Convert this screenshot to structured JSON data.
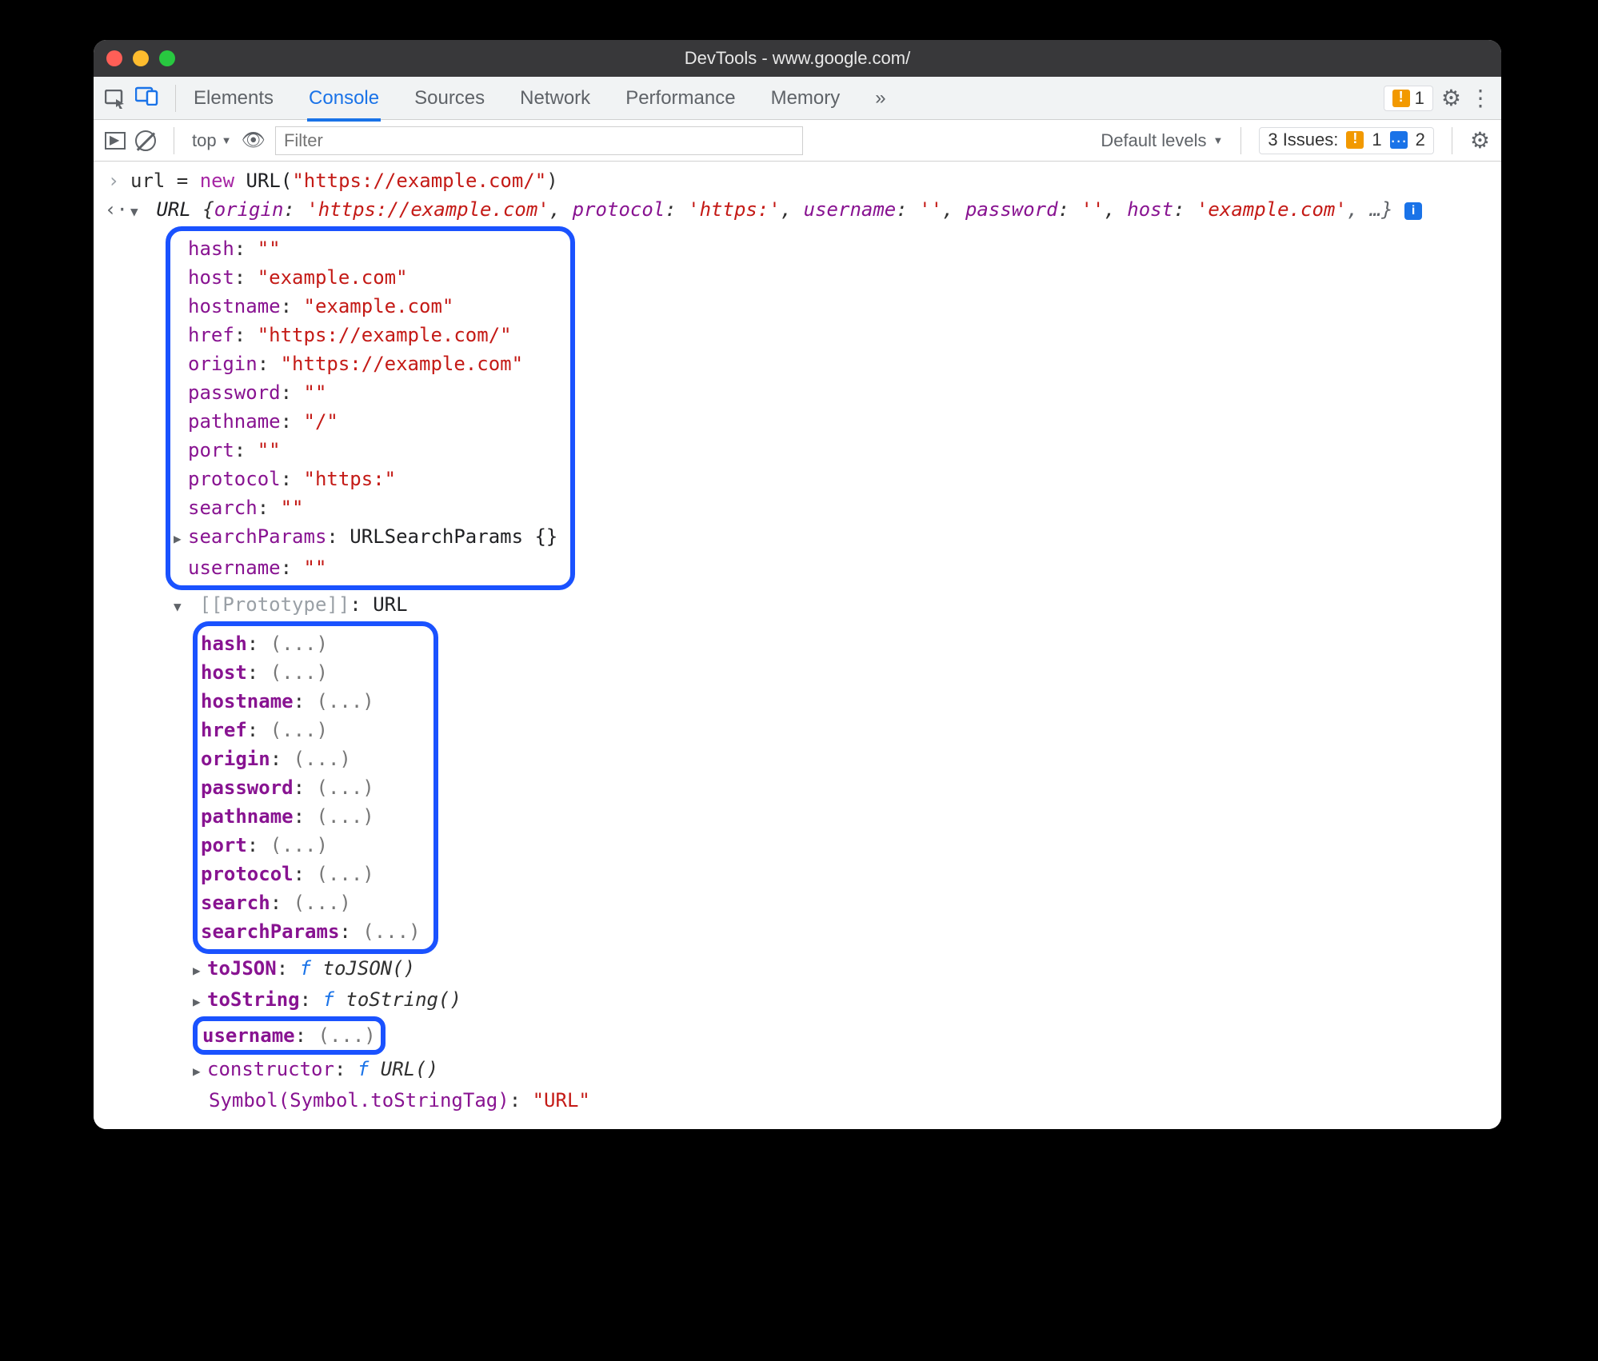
{
  "window": {
    "title": "DevTools - www.google.com/"
  },
  "tabs": [
    "Elements",
    "Console",
    "Sources",
    "Network",
    "Performance",
    "Memory"
  ],
  "active_tab": "Console",
  "more_tabs_glyph": "»",
  "warn_count": "1",
  "toolbar2": {
    "context": "top",
    "filter_placeholder": "Filter",
    "levels_label": "Default levels",
    "issues_label": "3 Issues:",
    "issues_warn": "1",
    "issues_info": "2"
  },
  "console": {
    "input_prefix": "url = ",
    "input_new": "new",
    "input_cls": " URL(",
    "input_arg": "\"https://example.com/\"",
    "input_close": ")",
    "summary_cls": "URL ",
    "summary_open": "{",
    "summary_pairs": [
      {
        "k": "origin",
        "v": "'https://example.com'"
      },
      {
        "k": "protocol",
        "v": "'https:'"
      },
      {
        "k": "username",
        "v": "''"
      },
      {
        "k": "password",
        "v": "''"
      },
      {
        "k": "host",
        "v": "'example.com'"
      }
    ],
    "summary_tail": ", …}",
    "props": [
      {
        "k": "hash",
        "v": "\"\""
      },
      {
        "k": "host",
        "v": "\"example.com\""
      },
      {
        "k": "hostname",
        "v": "\"example.com\""
      },
      {
        "k": "href",
        "v": "\"https://example.com/\""
      },
      {
        "k": "origin",
        "v": "\"https://example.com\""
      },
      {
        "k": "password",
        "v": "\"\""
      },
      {
        "k": "pathname",
        "v": "\"/\""
      },
      {
        "k": "port",
        "v": "\"\""
      },
      {
        "k": "protocol",
        "v": "\"https:\""
      },
      {
        "k": "search",
        "v": "\"\""
      }
    ],
    "searchParams_k": "searchParams",
    "searchParams_v": "URLSearchParams {}",
    "username_k": "username",
    "username_v": "\"\"",
    "proto_label": "[[Prototype]]",
    "proto_cls": "URL",
    "proto_accessors": [
      "hash",
      "host",
      "hostname",
      "href",
      "origin",
      "password",
      "pathname",
      "port",
      "protocol",
      "search",
      "searchParams"
    ],
    "accessor_val": "(...)",
    "toJSON_k": "toJSON",
    "toJSON_repr": "toJSON()",
    "toString_k": "toString",
    "toString_repr": "toString()",
    "proto_username_k": "username",
    "constructor_k": "constructor",
    "constructor_repr": "URL()",
    "symbol_k": "Symbol(Symbol.toStringTag)",
    "symbol_v": "\"URL\""
  }
}
